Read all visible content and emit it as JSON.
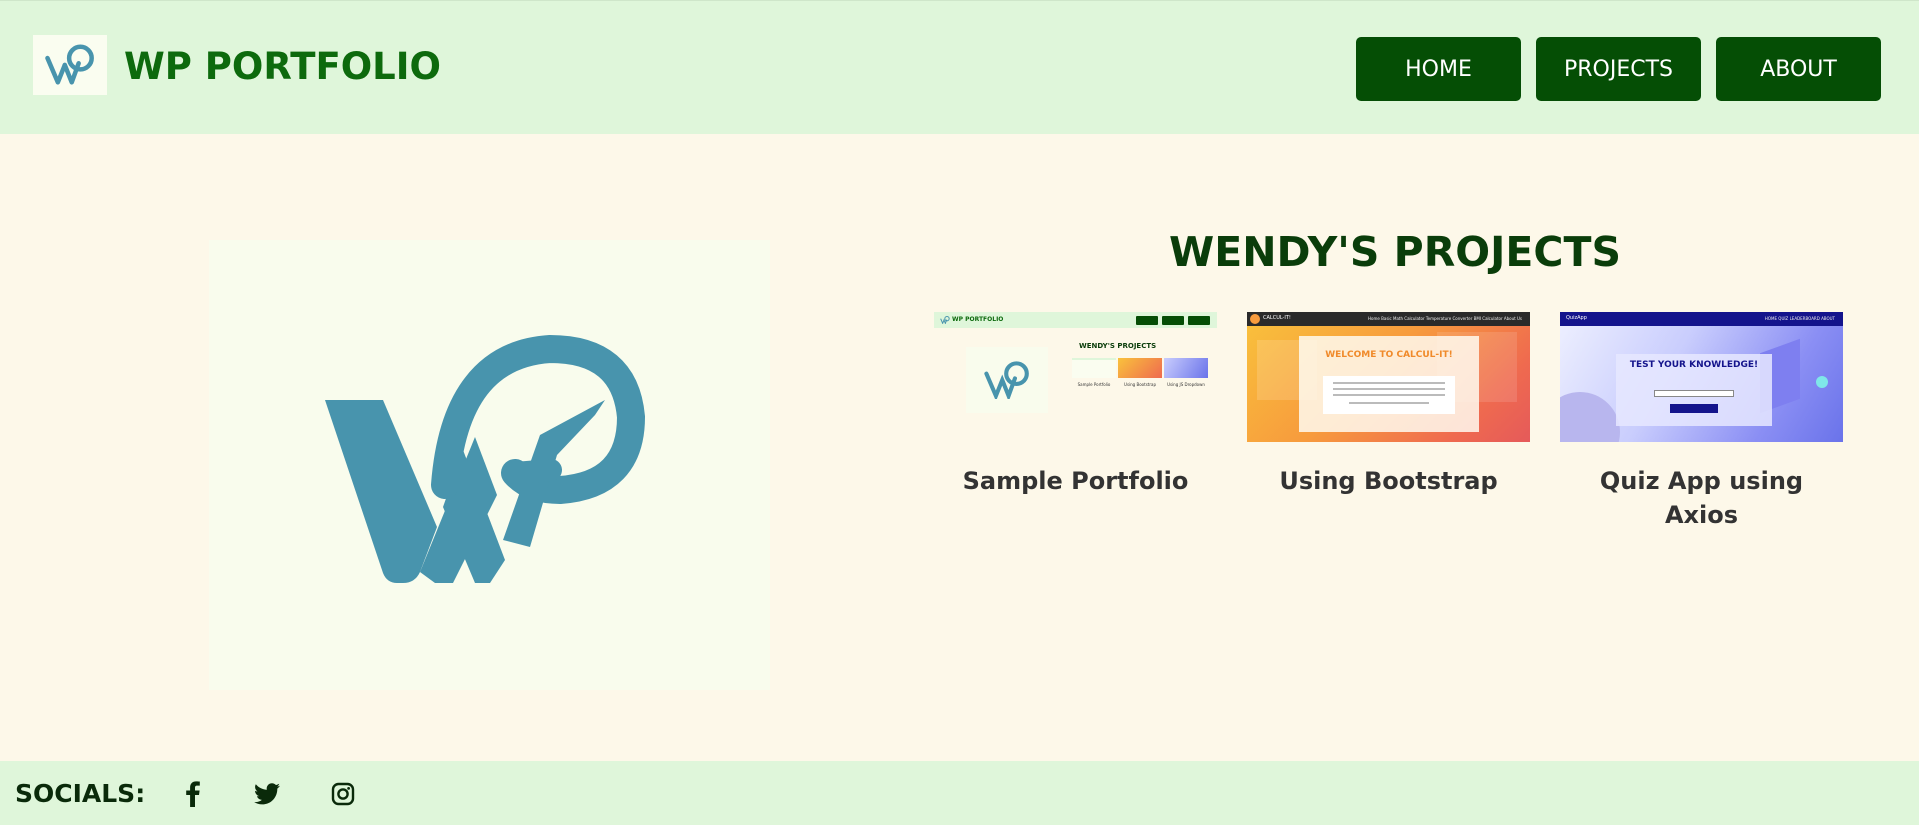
{
  "header": {
    "title": "WP PORTFOLIO",
    "logo_icon": "wp-monogram-icon",
    "nav": [
      {
        "label": "HOME"
      },
      {
        "label": "PROJECTS"
      },
      {
        "label": "ABOUT"
      }
    ]
  },
  "hero": {
    "logo_icon": "wp-monogram-icon"
  },
  "projects": {
    "title": "WENDY'S PROJECTS",
    "cards": [
      {
        "label": "Sample Portfolio",
        "thumb": {
          "title": "WP PORTFOLIO",
          "nav": [
            "HOME",
            "PROJECTS",
            "ABOUT"
          ],
          "heading": "WENDY'S PROJECTS",
          "items": [
            "Sample Portfolio",
            "Using Bootstrap",
            "Using JS Dropdown"
          ]
        }
      },
      {
        "label": "Using Bootstrap",
        "thumb": {
          "title": "CALCUL-IT!",
          "links": "Home   Basic Math Calculator   Temperature Converter   BMI Calculator   About Us",
          "heading": "WELCOME TO CALCUL-IT!"
        }
      },
      {
        "label": "Quiz App using Axios",
        "thumb": {
          "title": "QuizApp",
          "links": "HOME   QUIZ   LEADERBOARD   ABOUT",
          "heading": "TEST YOUR KNOWLEDGE!"
        }
      }
    ]
  },
  "footer": {
    "label": "SOCIALS:",
    "icons": [
      "facebook-icon",
      "twitter-icon",
      "instagram-icon"
    ]
  },
  "colors": {
    "header_bg": "#dff6da",
    "page_bg": "#fdf8e9",
    "nav_button": "#054e05",
    "title_green": "#0d6a0d",
    "logo_teal": "#4894ad"
  }
}
